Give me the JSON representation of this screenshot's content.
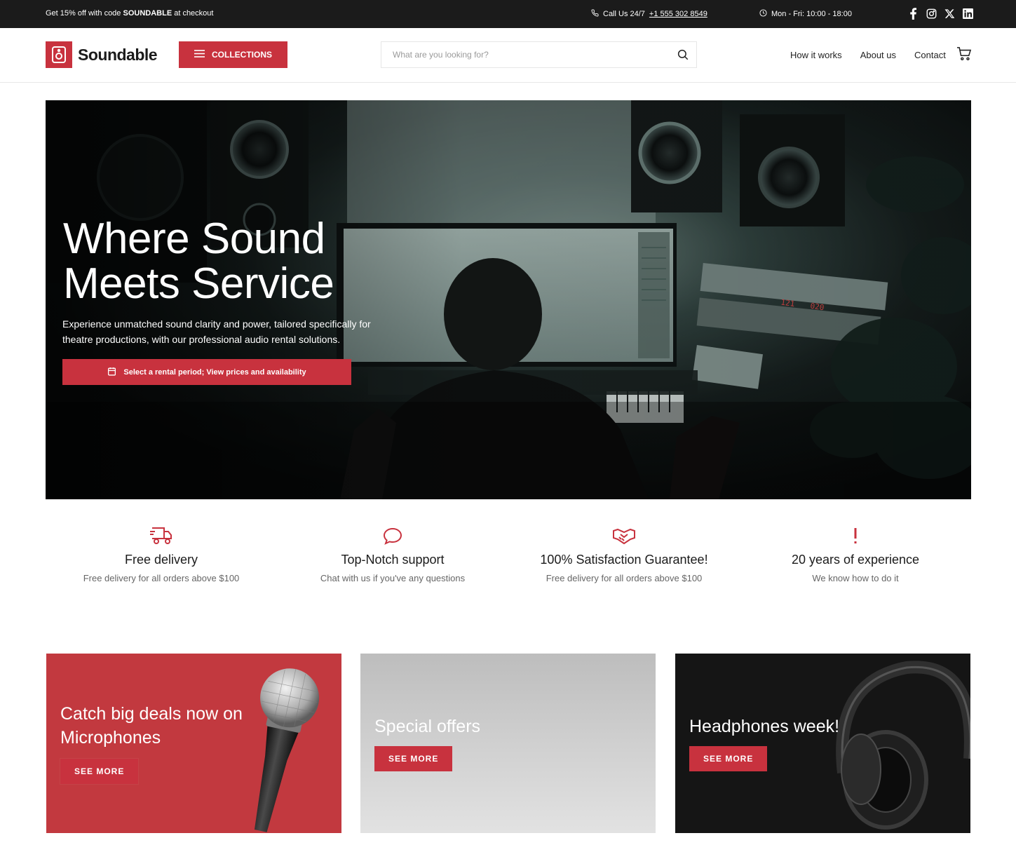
{
  "topbar": {
    "promo_prefix": "Get 15% off with code ",
    "promo_code": "SOUNDABLE",
    "promo_suffix": " at checkout",
    "call_label": "Call Us 24/7",
    "call_number": "+1 555 302 8549",
    "hours": "Mon - Fri: 10:00 - 18:00",
    "social": [
      "facebook-icon",
      "instagram-icon",
      "x-icon",
      "linkedin-icon"
    ]
  },
  "header": {
    "logo_text": "Soundable",
    "collections_label": "COLLECTIONS",
    "search_placeholder": "What are you looking for?",
    "nav": [
      "How it works",
      "About us",
      "Contact"
    ]
  },
  "hero": {
    "title_line1": "Where Sound",
    "title_line2": "Meets Service",
    "subtitle": "Experience unmatched sound clarity and power, tailored specifically for theatre productions, with our professional audio rental solutions.",
    "cta_label": "Select a rental period; View prices and availability",
    "display_text_1": "121",
    "display_text_2": "020"
  },
  "features": [
    {
      "icon": "truck-icon",
      "title": "Free delivery",
      "desc": "Free delivery for all orders above $100"
    },
    {
      "icon": "chat-icon",
      "title": "Top-Notch support",
      "desc": "Chat with us if you've any questions"
    },
    {
      "icon": "handshake-icon",
      "title": "100% Satisfaction Guarantee!",
      "desc": "Free delivery for all orders above $100"
    },
    {
      "icon": "exclamation-icon",
      "title": "20 years of experience",
      "desc": "We know how to do it"
    }
  ],
  "promos": [
    {
      "title_line1": "Catch big deals now on",
      "title_line2": "Microphones",
      "button": "SEE MORE"
    },
    {
      "title": "Special offers",
      "button": "SEE MORE"
    },
    {
      "title": "Headphones week!",
      "button": "SEE MORE"
    }
  ],
  "colors": {
    "accent": "#c8323e",
    "topbar": "#1b1b1b",
    "card_dark": "#151515"
  }
}
